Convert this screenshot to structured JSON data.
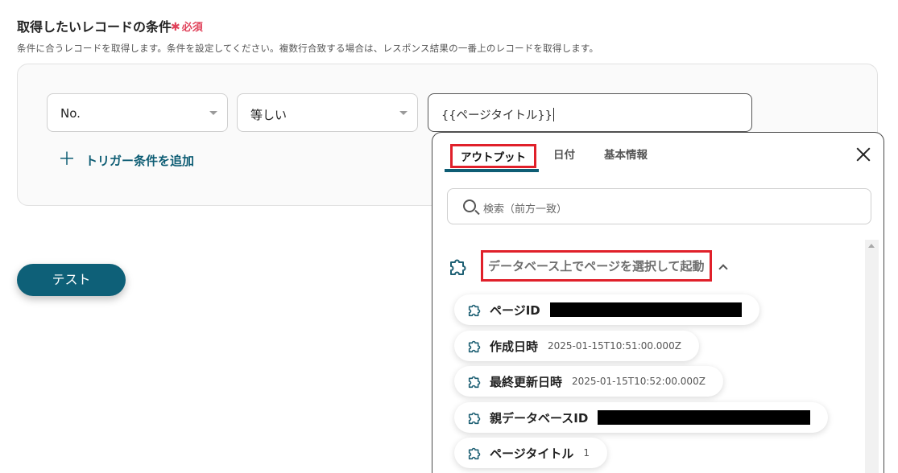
{
  "condition": {
    "title": "取得したいレコードの条件",
    "required_label": "必須",
    "description": "条件に合うレコードを取得します。条件を設定してください。複数行合致する場合は、レスポンス結果の一番上のレコードを取得します。",
    "field_select": {
      "value": "No."
    },
    "operator_select": {
      "value": "等しい"
    },
    "value_input": {
      "value": "{{ページタイトル}}"
    },
    "add_trigger_label": "トリガー条件を追加"
  },
  "test_button_label": "テスト",
  "output_panel": {
    "tabs": [
      {
        "label": "アウトプット",
        "active": true
      },
      {
        "label": "日付",
        "active": false
      },
      {
        "label": "基本情報",
        "active": false
      }
    ],
    "search_placeholder": "検索（前方一致）",
    "group_title": "データベース上でページを選択して起動",
    "items": [
      {
        "label": "ページID",
        "value": "",
        "redacted": true
      },
      {
        "label": "作成日時",
        "value": "2025-01-15T10:51:00.000Z",
        "redacted": false
      },
      {
        "label": "最終更新日時",
        "value": "2025-01-15T10:52:00.000Z",
        "redacted": false
      },
      {
        "label": "親データベースID",
        "value": "",
        "redacted": true
      },
      {
        "label": "ページタイトル",
        "value": "1",
        "redacted": false
      }
    ]
  },
  "colors": {
    "accent": "#0e5d74",
    "required": "#e0435b",
    "highlight_border": "#e0202a"
  }
}
